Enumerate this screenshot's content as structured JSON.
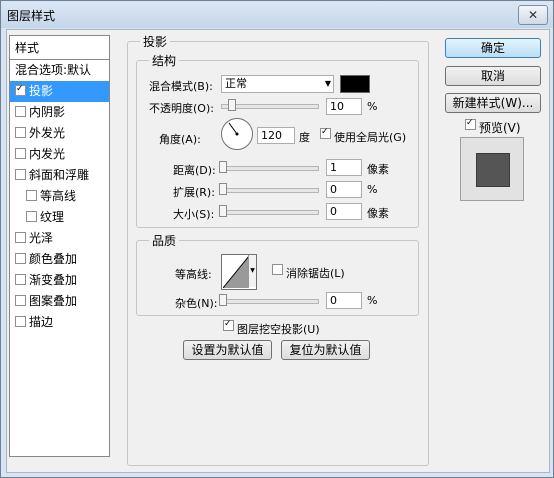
{
  "window": {
    "title": "图层样式",
    "close_label": "✕"
  },
  "style_list": {
    "header": "样式",
    "items": [
      {
        "label": "混合选项:默认",
        "checkbox": false,
        "checked": false,
        "indent": false,
        "selected": false
      },
      {
        "label": "投影",
        "checkbox": true,
        "checked": true,
        "indent": false,
        "selected": true
      },
      {
        "label": "内阴影",
        "checkbox": true,
        "checked": false,
        "indent": false,
        "selected": false
      },
      {
        "label": "外发光",
        "checkbox": true,
        "checked": false,
        "indent": false,
        "selected": false
      },
      {
        "label": "内发光",
        "checkbox": true,
        "checked": false,
        "indent": false,
        "selected": false
      },
      {
        "label": "斜面和浮雕",
        "checkbox": true,
        "checked": false,
        "indent": false,
        "selected": false
      },
      {
        "label": "等高线",
        "checkbox": true,
        "checked": false,
        "indent": true,
        "selected": false
      },
      {
        "label": "纹理",
        "checkbox": true,
        "checked": false,
        "indent": true,
        "selected": false
      },
      {
        "label": "光泽",
        "checkbox": true,
        "checked": false,
        "indent": false,
        "selected": false
      },
      {
        "label": "颜色叠加",
        "checkbox": true,
        "checked": false,
        "indent": false,
        "selected": false
      },
      {
        "label": "渐变叠加",
        "checkbox": true,
        "checked": false,
        "indent": false,
        "selected": false
      },
      {
        "label": "图案叠加",
        "checkbox": true,
        "checked": false,
        "indent": false,
        "selected": false
      },
      {
        "label": "描边",
        "checkbox": true,
        "checked": false,
        "indent": false,
        "selected": false
      }
    ]
  },
  "drop_shadow": {
    "title": "投影",
    "structure": {
      "title": "结构",
      "blend_mode_label": "混合模式(B):",
      "blend_mode_value": "正常",
      "shadow_color": "#000000",
      "opacity_label": "不透明度(O):",
      "opacity_value": "10",
      "opacity_unit": "%",
      "opacity_fraction": 0.1,
      "angle_label": "角度(A):",
      "angle_value": "120",
      "angle_unit": "度",
      "global_light_label": "使用全局光(G)",
      "global_light_checked": true,
      "distance_label": "距离(D):",
      "distance_value": "1",
      "distance_unit": "像素",
      "spread_label": "扩展(R):",
      "spread_value": "0",
      "spread_unit": "%",
      "size_label": "大小(S):",
      "size_value": "0",
      "size_unit": "像素"
    },
    "quality": {
      "title": "品质",
      "contour_label": "等高线:",
      "anti_alias_label": "消除锯齿(L)",
      "anti_alias_checked": false,
      "noise_label": "杂色(N):",
      "noise_value": "0",
      "noise_unit": "%"
    },
    "layer_knocks_out_label": "图层挖空投影(U)",
    "layer_knocks_out_checked": true,
    "make_default_label": "设置为默认值",
    "reset_default_label": "复位为默认值"
  },
  "buttons": {
    "ok": "确定",
    "cancel": "取消",
    "new_style": "新建样式(W)...",
    "preview_label": "预览(V)",
    "preview_checked": true
  },
  "colors": {
    "selection": "#3399ff",
    "preview_swatch": "#555555"
  }
}
